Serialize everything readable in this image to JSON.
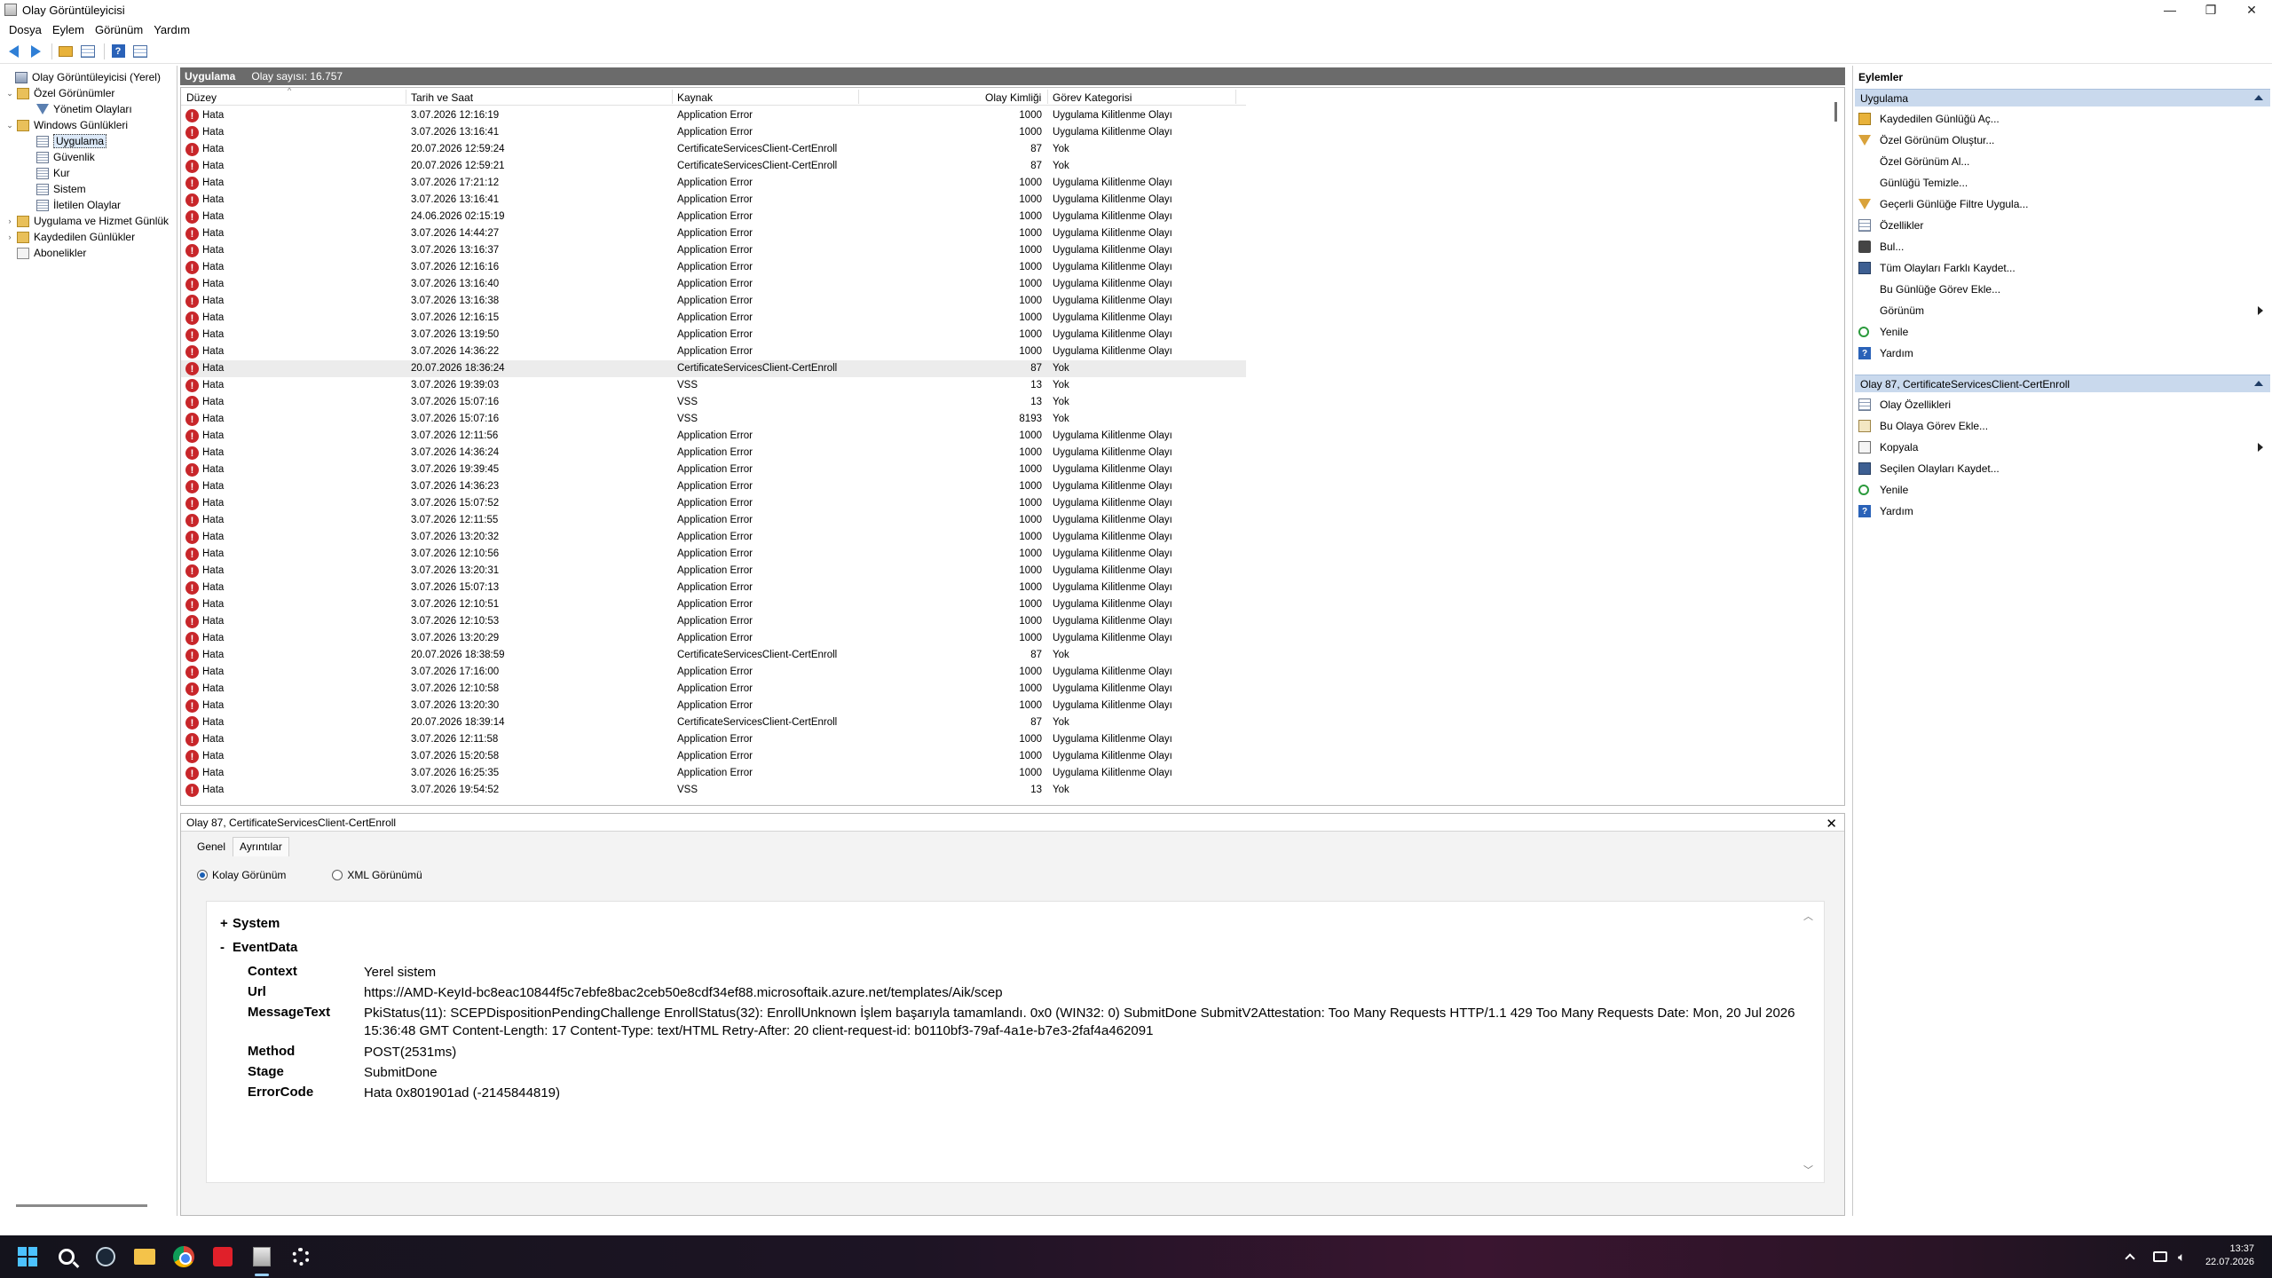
{
  "window": {
    "title": "Olay Görüntüleyicisi",
    "controls": {
      "minimize": "—",
      "maximize": "❐",
      "close": "✕"
    }
  },
  "menu": [
    "Dosya",
    "Eylem",
    "Görünüm",
    "Yardım"
  ],
  "tree": {
    "items": [
      {
        "label": "Olay Görüntüleyicisi (Yerel)",
        "expander": "",
        "icon": "computer-icon"
      },
      {
        "label": "Özel Görünümler",
        "expander": "⌄",
        "icon": "folder-icon"
      },
      {
        "label": "Yönetim Olayları",
        "expander": "",
        "icon": "filter-icon"
      },
      {
        "label": "Windows Günlükleri",
        "expander": "⌄",
        "icon": "folder-icon"
      },
      {
        "label": "Uygulama",
        "expander": "",
        "icon": "log-icon"
      },
      {
        "label": "Güvenlik",
        "expander": "",
        "icon": "log-icon"
      },
      {
        "label": "Kur",
        "expander": "",
        "icon": "log-icon"
      },
      {
        "label": "Sistem",
        "expander": "",
        "icon": "log-icon"
      },
      {
        "label": "İletilen Olaylar",
        "expander": "",
        "icon": "log-icon"
      },
      {
        "label": "Uygulama ve Hizmet Günlük",
        "expander": "›",
        "icon": "folder-icon"
      },
      {
        "label": "Kaydedilen Günlükler",
        "expander": "›",
        "icon": "folder-icon"
      },
      {
        "label": "Abonelikler",
        "expander": "",
        "icon": "subscription-icon"
      }
    ]
  },
  "log": {
    "name": "Uygulama",
    "count": "Olay sayısı: 16.757",
    "columns": {
      "level": "Düzey",
      "date": "Tarih ve Saat",
      "source": "Kaynak",
      "id": "Olay Kimliği",
      "category": "Görev Kategorisi"
    },
    "rows": [
      [
        "Hata",
        "3.07.2026 12:16:19",
        "Application Error",
        "1000",
        "Uygulama Kilitlenme Olayı"
      ],
      [
        "Hata",
        "3.07.2026 13:16:41",
        "Application Error",
        "1000",
        "Uygulama Kilitlenme Olayı"
      ],
      [
        "Hata",
        "20.07.2026 12:59:24",
        "CertificateServicesClient-CertEnroll",
        "87",
        "Yok"
      ],
      [
        "Hata",
        "20.07.2026 12:59:21",
        "CertificateServicesClient-CertEnroll",
        "87",
        "Yok"
      ],
      [
        "Hata",
        "3.07.2026 17:21:12",
        "Application Error",
        "1000",
        "Uygulama Kilitlenme Olayı"
      ],
      [
        "Hata",
        "3.07.2026 13:16:41",
        "Application Error",
        "1000",
        "Uygulama Kilitlenme Olayı"
      ],
      [
        "Hata",
        "24.06.2026 02:15:19",
        "Application Error",
        "1000",
        "Uygulama Kilitlenme Olayı"
      ],
      [
        "Hata",
        "3.07.2026 14:44:27",
        "Application Error",
        "1000",
        "Uygulama Kilitlenme Olayı"
      ],
      [
        "Hata",
        "3.07.2026 13:16:37",
        "Application Error",
        "1000",
        "Uygulama Kilitlenme Olayı"
      ],
      [
        "Hata",
        "3.07.2026 12:16:16",
        "Application Error",
        "1000",
        "Uygulama Kilitlenme Olayı"
      ],
      [
        "Hata",
        "3.07.2026 13:16:40",
        "Application Error",
        "1000",
        "Uygulama Kilitlenme Olayı"
      ],
      [
        "Hata",
        "3.07.2026 13:16:38",
        "Application Error",
        "1000",
        "Uygulama Kilitlenme Olayı"
      ],
      [
        "Hata",
        "3.07.2026 12:16:15",
        "Application Error",
        "1000",
        "Uygulama Kilitlenme Olayı"
      ],
      [
        "Hata",
        "3.07.2026 13:19:50",
        "Application Error",
        "1000",
        "Uygulama Kilitlenme Olayı"
      ],
      [
        "Hata",
        "3.07.2026 14:36:22",
        "Application Error",
        "1000",
        "Uygulama Kilitlenme Olayı"
      ],
      [
        "Hata",
        "20.07.2026 18:36:24",
        "CertificateServicesClient-CertEnroll",
        "87",
        "Yok"
      ],
      [
        "Hata",
        "3.07.2026 19:39:03",
        "VSS",
        "13",
        "Yok"
      ],
      [
        "Hata",
        "3.07.2026 15:07:16",
        "VSS",
        "13",
        "Yok"
      ],
      [
        "Hata",
        "3.07.2026 15:07:16",
        "VSS",
        "8193",
        "Yok"
      ],
      [
        "Hata",
        "3.07.2026 12:11:56",
        "Application Error",
        "1000",
        "Uygulama Kilitlenme Olayı"
      ],
      [
        "Hata",
        "3.07.2026 14:36:24",
        "Application Error",
        "1000",
        "Uygulama Kilitlenme Olayı"
      ],
      [
        "Hata",
        "3.07.2026 19:39:45",
        "Application Error",
        "1000",
        "Uygulama Kilitlenme Olayı"
      ],
      [
        "Hata",
        "3.07.2026 14:36:23",
        "Application Error",
        "1000",
        "Uygulama Kilitlenme Olayı"
      ],
      [
        "Hata",
        "3.07.2026 15:07:52",
        "Application Error",
        "1000",
        "Uygulama Kilitlenme Olayı"
      ],
      [
        "Hata",
        "3.07.2026 12:11:55",
        "Application Error",
        "1000",
        "Uygulama Kilitlenme Olayı"
      ],
      [
        "Hata",
        "3.07.2026 13:20:32",
        "Application Error",
        "1000",
        "Uygulama Kilitlenme Olayı"
      ],
      [
        "Hata",
        "3.07.2026 12:10:56",
        "Application Error",
        "1000",
        "Uygulama Kilitlenme Olayı"
      ],
      [
        "Hata",
        "3.07.2026 13:20:31",
        "Application Error",
        "1000",
        "Uygulama Kilitlenme Olayı"
      ],
      [
        "Hata",
        "3.07.2026 15:07:13",
        "Application Error",
        "1000",
        "Uygulama Kilitlenme Olayı"
      ],
      [
        "Hata",
        "3.07.2026 12:10:51",
        "Application Error",
        "1000",
        "Uygulama Kilitlenme Olayı"
      ],
      [
        "Hata",
        "3.07.2026 12:10:53",
        "Application Error",
        "1000",
        "Uygulama Kilitlenme Olayı"
      ],
      [
        "Hata",
        "3.07.2026 13:20:29",
        "Application Error",
        "1000",
        "Uygulama Kilitlenme Olayı"
      ],
      [
        "Hata",
        "20.07.2026 18:38:59",
        "CertificateServicesClient-CertEnroll",
        "87",
        "Yok"
      ],
      [
        "Hata",
        "3.07.2026 17:16:00",
        "Application Error",
        "1000",
        "Uygulama Kilitlenme Olayı"
      ],
      [
        "Hata",
        "3.07.2026 12:10:58",
        "Application Error",
        "1000",
        "Uygulama Kilitlenme Olayı"
      ],
      [
        "Hata",
        "3.07.2026 13:20:30",
        "Application Error",
        "1000",
        "Uygulama Kilitlenme Olayı"
      ],
      [
        "Hata",
        "20.07.2026 18:39:14",
        "CertificateServicesClient-CertEnroll",
        "87",
        "Yok"
      ],
      [
        "Hata",
        "3.07.2026 12:11:58",
        "Application Error",
        "1000",
        "Uygulama Kilitlenme Olayı"
      ],
      [
        "Hata",
        "3.07.2026 15:20:58",
        "Application Error",
        "1000",
        "Uygulama Kilitlenme Olayı"
      ],
      [
        "Hata",
        "3.07.2026 16:25:35",
        "Application Error",
        "1000",
        "Uygulama Kilitlenme Olayı"
      ],
      [
        "Hata",
        "3.07.2026 19:54:52",
        "VSS",
        "13",
        "Yok"
      ]
    ],
    "selected_row": 15
  },
  "detail": {
    "title": "Olay 87, CertificateServicesClient-CertEnroll",
    "close": "✕",
    "tabs": [
      "Genel",
      "Ayrıntılar"
    ],
    "active_tab": 1,
    "view_friendly": "Kolay Görünüm",
    "view_xml": "XML Görünümü",
    "system_label": "System",
    "system_toggle": "+",
    "eventdata_label": "EventData",
    "eventdata_toggle": "-",
    "fields": [
      {
        "key": "Context",
        "value": "Yerel sistem"
      },
      {
        "key": "Url",
        "value": "https://AMD-KeyId-bc8eac10844f5c7ebfe8bac2ceb50e8cdf34ef88.microsoftaik.azure.net/templates/Aik/scep"
      },
      {
        "key": "MessageText",
        "value": "PkiStatus(11): SCEPDispositionPendingChallenge EnrollStatus(32): EnrollUnknown İşlem başarıyla tamamlandı. 0x0 (WIN32: 0) SubmitDone SubmitV2Attestation: Too Many Requests HTTP/1.1 429 Too Many Requests Date: Mon, 20 Jul 2026 15:36:48 GMT Content-Length: 17 Content-Type: text/HTML Retry-After: 20 client-request-id: b0110bf3-79af-4a1e-b7e3-2faf4a462091"
      },
      {
        "key": "Method",
        "value": "POST(2531ms)"
      },
      {
        "key": "Stage",
        "value": "SubmitDone"
      },
      {
        "key": "ErrorCode",
        "value": "Hata 0x801901ad (-2145844819)"
      }
    ]
  },
  "actions": {
    "title": "Eylemler",
    "group1": {
      "label": "Uygulama",
      "items": [
        {
          "label": "Kaydedilen Günlüğü Aç...",
          "icon": "open-log-icon",
          "submenu": false
        },
        {
          "label": "Özel Görünüm Oluştur...",
          "icon": "filter-icon",
          "submenu": false
        },
        {
          "label": "Özel Görünüm Al...",
          "icon": "",
          "submenu": false
        },
        {
          "label": "Günlüğü Temizle...",
          "icon": "",
          "submenu": false
        },
        {
          "label": "Geçerli Günlüğe Filtre Uygula...",
          "icon": "filter-icon",
          "submenu": false
        },
        {
          "label": "Özellikler",
          "icon": "properties-icon",
          "submenu": false
        },
        {
          "label": "Bul...",
          "icon": "find-icon",
          "submenu": false
        },
        {
          "label": "Tüm Olayları Farklı Kaydet...",
          "icon": "save-icon",
          "submenu": false
        },
        {
          "label": "Bu Günlüğe Görev Ekle...",
          "icon": "",
          "submenu": false
        },
        {
          "label": "Görünüm",
          "icon": "",
          "submenu": true
        },
        {
          "label": "Yenile",
          "icon": "refresh-icon",
          "submenu": false
        },
        {
          "label": "Yardım",
          "icon": "help-icon",
          "submenu": false
        }
      ]
    },
    "group2": {
      "label": "Olay 87, CertificateServicesClient-CertEnroll",
      "items": [
        {
          "label": "Olay Özellikleri",
          "icon": "properties-icon",
          "submenu": false
        },
        {
          "label": "Bu Olaya Görev Ekle...",
          "icon": "task-icon",
          "submenu": false
        },
        {
          "label": "Kopyala",
          "icon": "copy-icon",
          "submenu": true
        },
        {
          "label": "Seçilen Olayları Kaydet...",
          "icon": "save-icon",
          "submenu": false
        },
        {
          "label": "Yenile",
          "icon": "refresh-icon",
          "submenu": false
        },
        {
          "label": "Yardım",
          "icon": "help-icon",
          "submenu": false
        }
      ]
    }
  },
  "taskbar": {
    "apps": [
      "start-icon",
      "search-icon",
      "steam-icon",
      "file-explorer-icon",
      "chrome-icon",
      "red-app-icon",
      "event-viewer-icon",
      "settings-icon"
    ],
    "time": "13:37",
    "date": "22.07.2026"
  },
  "colors": {
    "error": "#c8262a",
    "action_group": "#c9d9ed",
    "log_header": "#6b6b6b"
  }
}
